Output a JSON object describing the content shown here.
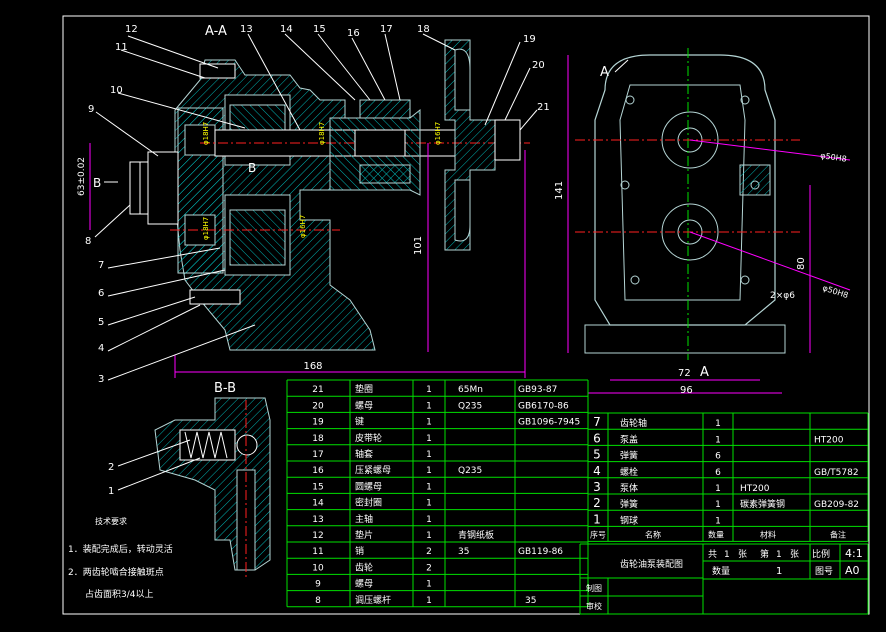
{
  "drawing": {
    "section_aa": "A-A",
    "section_bb": "B-B",
    "view_mark_a": "A",
    "view_mark_b": "B",
    "balloons_main": [
      "12",
      "11",
      "10",
      "9",
      "8",
      "7",
      "6",
      "5",
      "4",
      "3",
      "13",
      "14",
      "15",
      "16",
      "17",
      "18",
      "19",
      "20",
      "21"
    ],
    "balloons_bb": [
      "2",
      "1"
    ],
    "dims": {
      "width_168": "168",
      "height_101": "101",
      "side_width_72": "72",
      "side_width_96": "96",
      "side_height_141": "141",
      "side_height_80": "80",
      "hole_2x6": "2×φ6",
      "dia_50_top": "φ50H8",
      "dia_50_bot": "φ50H8",
      "left_vertical": "63±0.02"
    },
    "notes": {
      "title": "技术要求",
      "line1": "1．装配完成后，转动灵活",
      "line2": "2．两齿轮啮合接触斑点",
      "line3": "占齿面积3/4以上"
    }
  },
  "bom_left": {
    "rows": [
      {
        "no": "21",
        "name": "垫圈",
        "qty": "1",
        "material": "65Mn",
        "std": "GB93-87",
        "note": ""
      },
      {
        "no": "20",
        "name": "螺母",
        "qty": "1",
        "material": "Q235",
        "std": "GB6170-86",
        "note": ""
      },
      {
        "no": "19",
        "name": "键",
        "qty": "1",
        "material": "",
        "std": "GB1096-7945",
        "note": ""
      },
      {
        "no": "18",
        "name": "皮带轮",
        "qty": "1",
        "material": "",
        "std": "",
        "note": ""
      },
      {
        "no": "17",
        "name": "轴套",
        "qty": "1",
        "material": "",
        "std": "",
        "note": ""
      },
      {
        "no": "16",
        "name": "压紧螺母",
        "qty": "1",
        "material": "Q235",
        "std": "",
        "note": ""
      },
      {
        "no": "15",
        "name": "圆螺母",
        "qty": "1",
        "material": "",
        "std": "",
        "note": ""
      },
      {
        "no": "14",
        "name": "密封圈",
        "qty": "1",
        "material": "",
        "std": "",
        "note": ""
      },
      {
        "no": "13",
        "name": "主轴",
        "qty": "1",
        "material": "",
        "std": "",
        "note": ""
      },
      {
        "no": "12",
        "name": "垫片",
        "qty": "1",
        "material": "青钢纸板",
        "std": "",
        "note": ""
      },
      {
        "no": "11",
        "name": "销",
        "qty": "2",
        "material": "35",
        "std": "GB119-86",
        "note": ""
      },
      {
        "no": "10",
        "name": "齿轮",
        "qty": "2",
        "material": "",
        "std": "",
        "note": ""
      },
      {
        "no": "9",
        "name": "螺母",
        "qty": "1",
        "material": "",
        "std": "",
        "note": ""
      },
      {
        "no": "8",
        "name": "调压螺杆",
        "qty": "1",
        "material": "",
        "std": "",
        "note": "35"
      }
    ]
  },
  "bom_right": {
    "rows": [
      {
        "no": "7",
        "name": "齿轮轴",
        "qty": "1",
        "material": "",
        "note": ""
      },
      {
        "no": "6",
        "name": "泵盖",
        "qty": "1",
        "material": "",
        "note": "HT200"
      },
      {
        "no": "5",
        "name": "弹簧",
        "qty": "6",
        "material": "",
        "note": ""
      },
      {
        "no": "4",
        "name": "螺栓",
        "qty": "6",
        "material": "",
        "note": "GB/T5782"
      },
      {
        "no": "3",
        "name": "泵体",
        "qty": "1",
        "material": "HT200",
        "note": ""
      },
      {
        "no": "2",
        "name": "弹簧",
        "qty": "1",
        "material": "碳素弹簧钢",
        "note": "GB209-82"
      },
      {
        "no": "1",
        "name": "钢球",
        "qty": "1",
        "material": "",
        "note": ""
      }
    ],
    "header": {
      "no": "序号",
      "name": "名称",
      "qty": "数量",
      "material": "材料",
      "note": "备注"
    }
  },
  "title_block": {
    "drawing_name": "齿轮油泵装配图",
    "sheet_total_label": "共",
    "sheet_total": "1",
    "sheet_unit": "张",
    "sheet_label": "第",
    "sheet_no": "1",
    "sheet_unit2": "张",
    "scale_label": "比例",
    "scale": "4:1",
    "qty_label": "数量",
    "qty": "1",
    "drawing_no_label": "图号",
    "drawing_no": "A0",
    "drawn_label": "制图",
    "checked_label": "审校"
  },
  "colors": {
    "frame": "#ffffff",
    "part": "#b4d4d4",
    "hatch": "#00b6b6",
    "dim": "#ff00ff",
    "center": "#ff2020",
    "table_line": "#00e000",
    "text": "#ffffff",
    "yellow": "#ffff00"
  }
}
